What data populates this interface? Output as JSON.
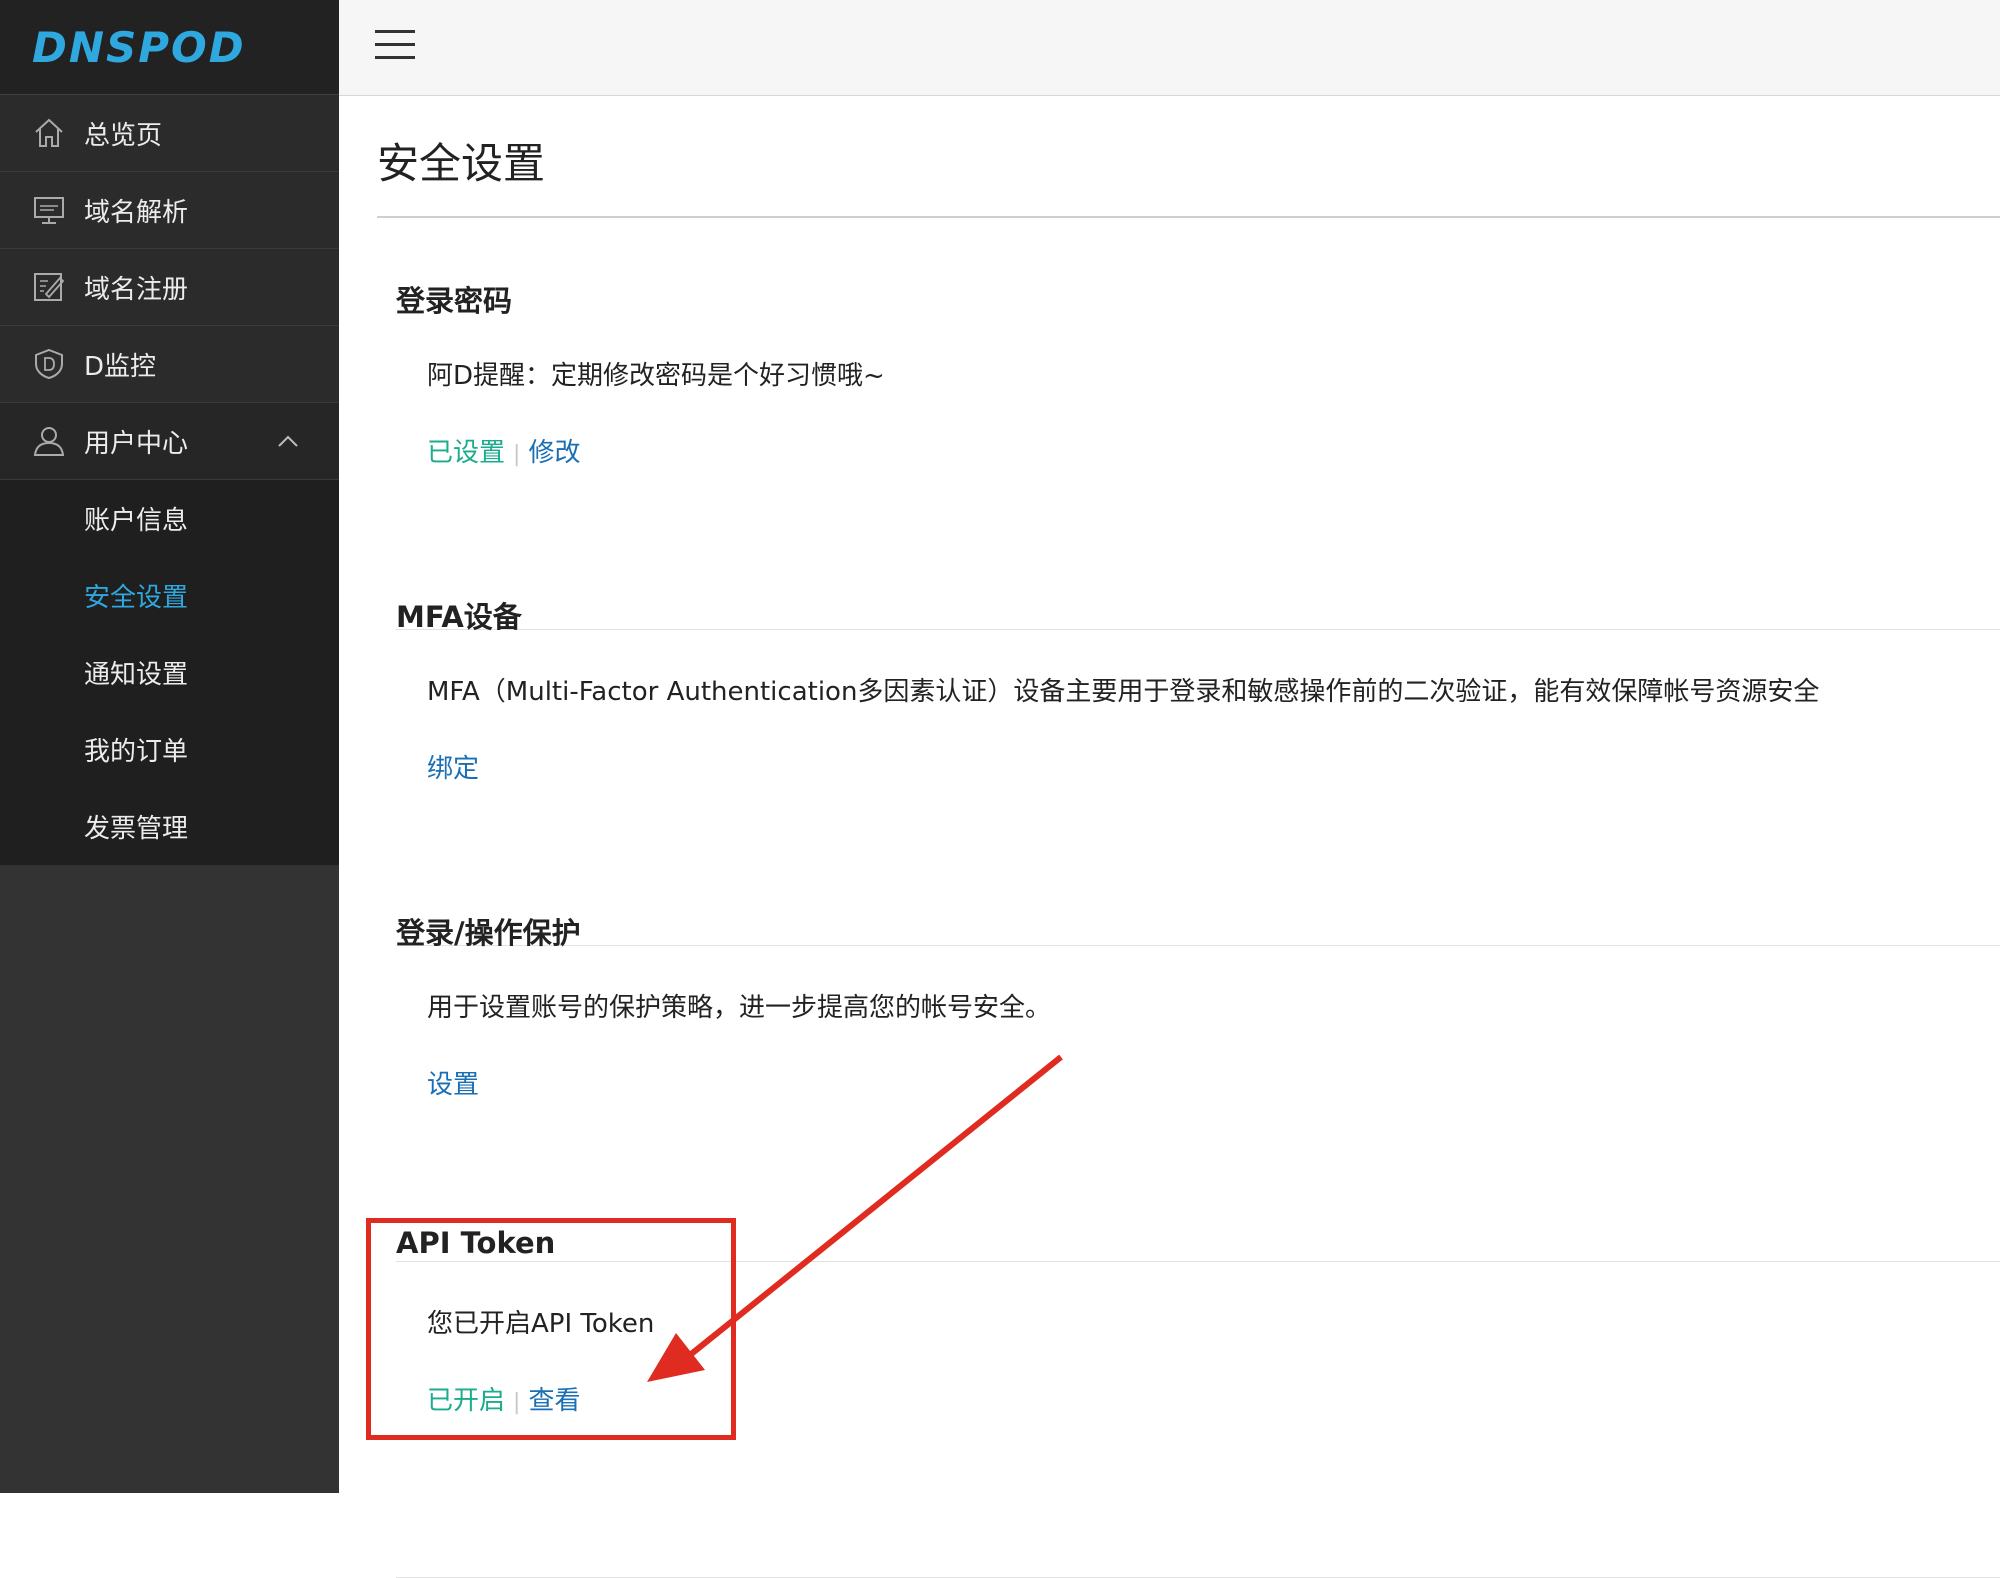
{
  "app": {
    "logo": "DNSPOD"
  },
  "sidebar": {
    "items": [
      {
        "label": "总览页",
        "icon": "home-icon"
      },
      {
        "label": "域名解析",
        "icon": "monitor-icon"
      },
      {
        "label": "域名注册",
        "icon": "edit-icon"
      },
      {
        "label": "D监控",
        "icon": "shield-icon"
      },
      {
        "label": "用户中心",
        "icon": "user-icon",
        "expanded": true
      }
    ],
    "submenu": [
      {
        "label": "账户信息"
      },
      {
        "label": "安全设置",
        "active": true
      },
      {
        "label": "通知设置"
      },
      {
        "label": "我的订单"
      },
      {
        "label": "发票管理"
      }
    ]
  },
  "page": {
    "title": "安全设置"
  },
  "sections": {
    "password": {
      "title": "登录密码",
      "desc": "阿D提醒：定期修改密码是个好习惯哦~",
      "status": "已设置",
      "action": "修改"
    },
    "mfa": {
      "title": "MFA设备",
      "desc": "MFA（Multi-Factor Authentication多因素认证）设备主要用于登录和敏感操作前的二次验证，能有效保障帐号资源安全",
      "action": "绑定"
    },
    "protect": {
      "title": "登录/操作保护",
      "desc": "用于设置账号的保护策略，进一步提高您的帐号安全。",
      "action": "设置"
    },
    "token": {
      "title": "API Token",
      "desc": "您已开启API Token",
      "status": "已开启",
      "action": "查看"
    }
  },
  "colors": {
    "accent_blue": "#2fa8df",
    "link_blue": "#1a6fb4",
    "status_green": "#1aac8c",
    "annotation_red": "#e02b20",
    "sidebar_bg": "#333333"
  }
}
